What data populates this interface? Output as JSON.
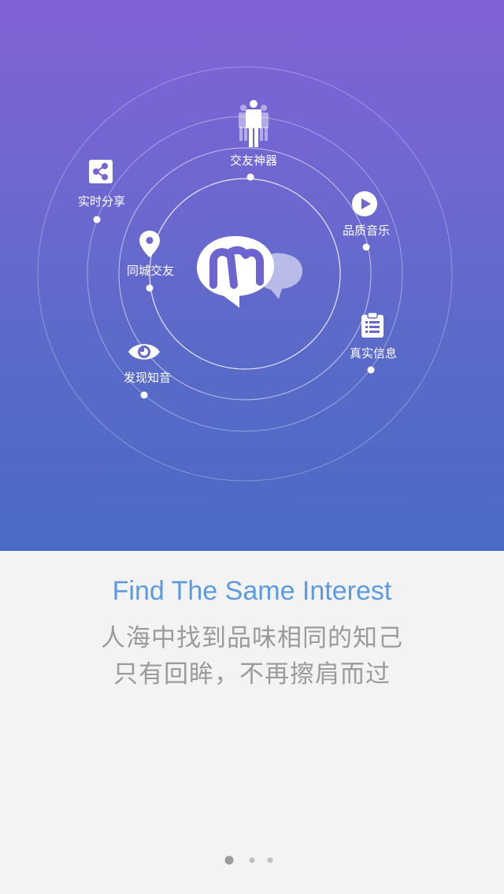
{
  "hero": {
    "features": [
      {
        "id": "friend",
        "label": "交友神器",
        "icon": "people-icon"
      },
      {
        "id": "share",
        "label": "实时分享",
        "icon": "share-icon"
      },
      {
        "id": "music",
        "label": "品质音乐",
        "icon": "play-icon"
      },
      {
        "id": "local",
        "label": "同城交友",
        "icon": "location-pin-icon"
      },
      {
        "id": "real",
        "label": "真实信息",
        "icon": "clipboard-list-icon"
      },
      {
        "id": "discover",
        "label": "发现知音",
        "icon": "eye-icon"
      }
    ],
    "logo_icon": "chat-bubble-m-logo"
  },
  "intro": {
    "headline": "Find The Same Interest",
    "line1": "人海中找到品味相同的知己",
    "line2": "只有回眸，不再擦肩而过"
  },
  "pager": {
    "total": 3,
    "active_index": 0
  },
  "colors": {
    "gradient_top": "#8262d6",
    "gradient_bottom": "#4a6bc5",
    "headline": "#5c9be0",
    "subtext": "#9b9b9b",
    "background": "#f3f3f3"
  }
}
